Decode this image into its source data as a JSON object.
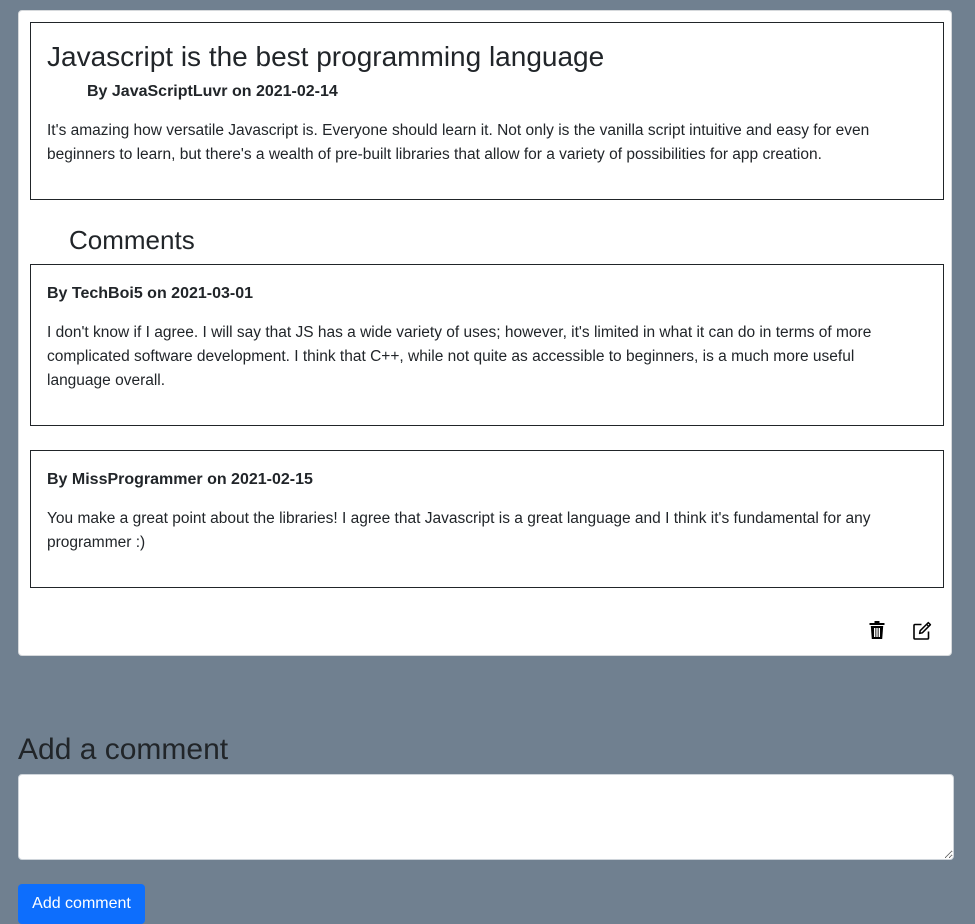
{
  "post": {
    "title": "Javascript is the best programming language",
    "meta": "By JavaScriptLuvr on 2021-02-14",
    "body": "It's amazing how versatile Javascript is. Everyone should learn it. Not only is the vanilla script intuitive and easy for even beginners to learn, but there's a wealth of pre-built libraries that allow for a variety of possibilities for app creation."
  },
  "comments_heading": "Comments",
  "comments": [
    {
      "meta": "By TechBoi5 on 2021-03-01",
      "body": "I don't know if I agree. I will say that JS has a wide variety of uses; however, it's limited in what it can do in terms of more complicated software development. I think that C++, while not quite as accessible to beginners, is a much more useful language overall."
    },
    {
      "meta": "By MissProgrammer on 2021-02-15",
      "body": "You make a great point about the libraries! I agree that Javascript is a great language and I think it's fundamental for any programmer :)"
    }
  ],
  "actions": {
    "delete_icon": "trash-icon",
    "edit_icon": "edit-icon"
  },
  "add_comment": {
    "heading": "Add a comment",
    "input_value": "",
    "input_placeholder": "",
    "button_label": "Add comment",
    "button_color": "#0d6efd"
  },
  "colors": {
    "page_background": "#708090",
    "card_background": "#ffffff",
    "text": "#212529"
  }
}
